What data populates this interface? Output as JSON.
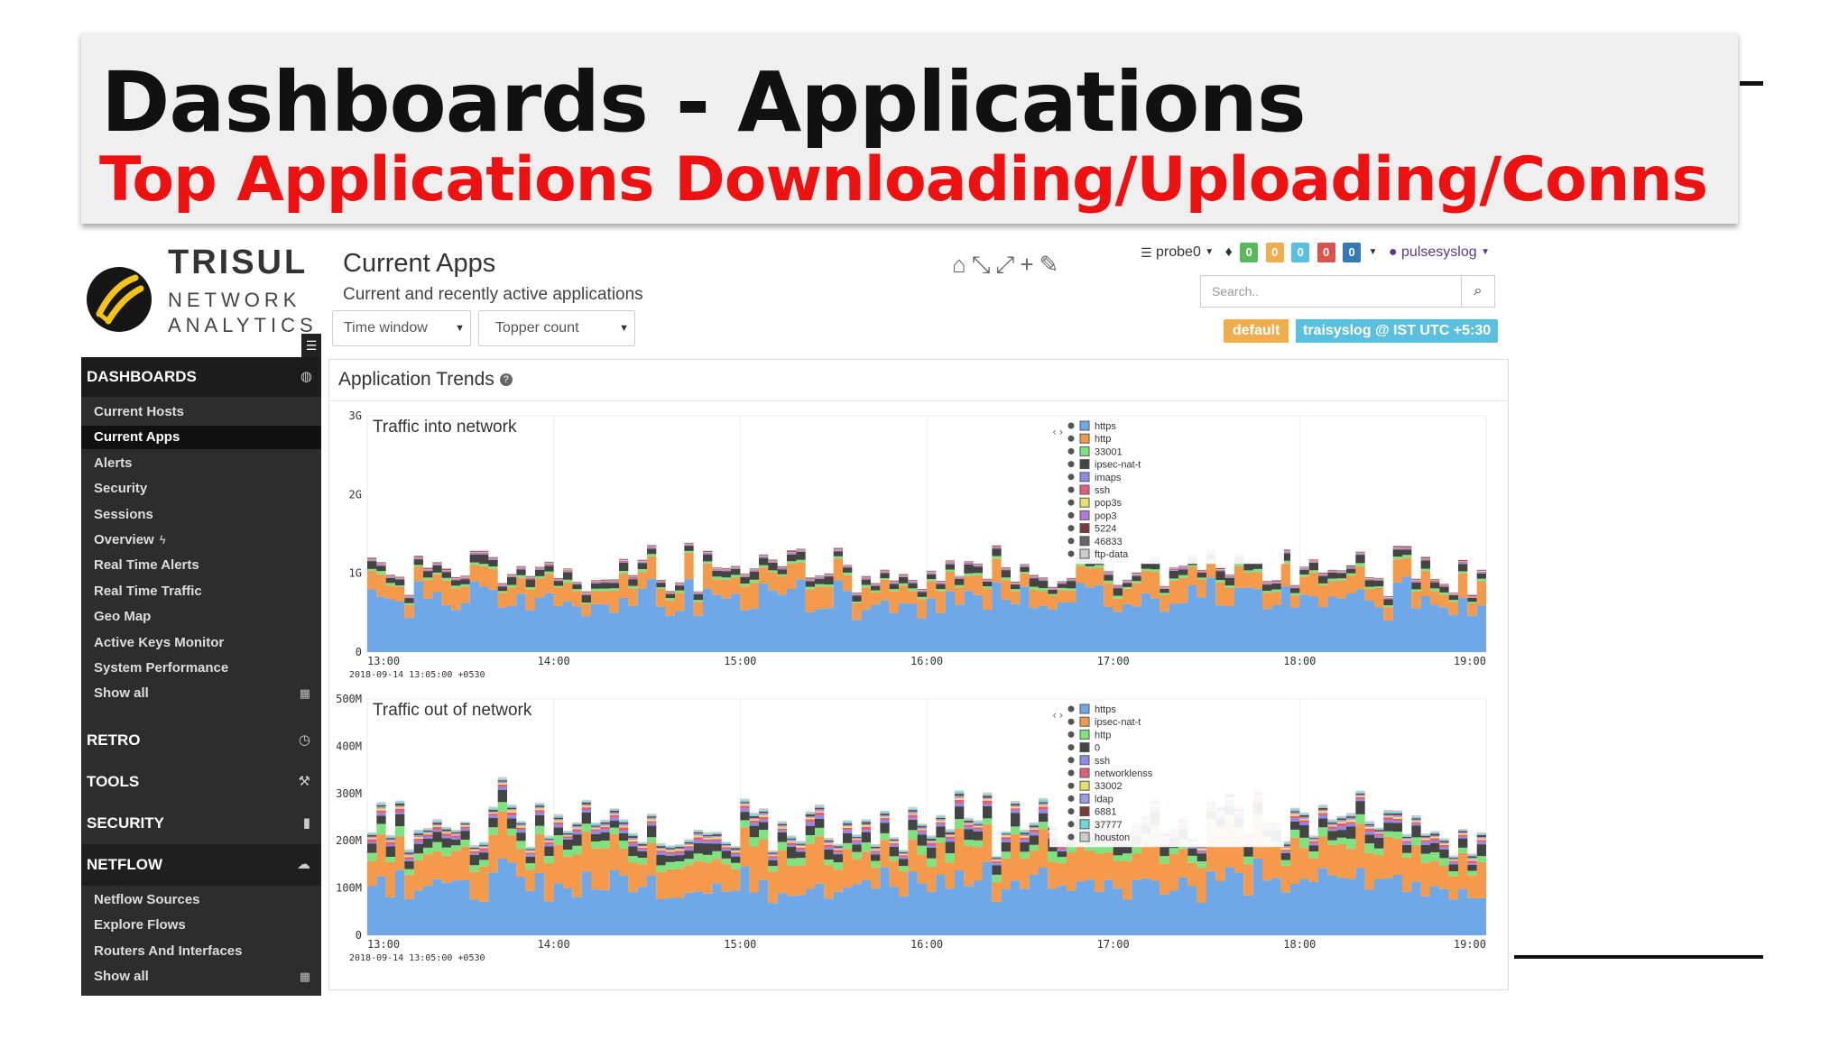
{
  "slide": {
    "title": "Dashboards - Applications",
    "subtitle": "Top Applications Downloading/Uploading/Conns"
  },
  "logo": {
    "name": "TRISUL",
    "line2": "NETWORK",
    "line3": "ANALYTICS"
  },
  "sidebar": {
    "dashboards_label": "DASHBOARDS",
    "dashboard_items": [
      {
        "label": "Current Hosts"
      },
      {
        "label": "Current Apps",
        "active": true
      },
      {
        "label": "Alerts"
      },
      {
        "label": "Security"
      },
      {
        "label": "Sessions"
      },
      {
        "label": "Overview"
      },
      {
        "label": "Real Time Alerts"
      },
      {
        "label": "Real Time Traffic"
      },
      {
        "label": "Geo Map"
      },
      {
        "label": "Active Keys Monitor"
      },
      {
        "label": "System Performance"
      },
      {
        "label": "Show all"
      }
    ],
    "sections": [
      {
        "label": "RETRO",
        "icon": "clock-icon"
      },
      {
        "label": "TOOLS",
        "icon": "wrench-icon"
      },
      {
        "label": "SECURITY",
        "icon": "lock-icon"
      },
      {
        "label": "NETFLOW",
        "icon": "cloud-icon"
      }
    ],
    "netflow_items": [
      {
        "label": "Netflow Sources"
      },
      {
        "label": "Explore Flows"
      },
      {
        "label": "Routers And Interfaces"
      },
      {
        "label": "Show all"
      }
    ]
  },
  "header": {
    "title": "Current Apps",
    "subtitle": "Current and recently active applications",
    "time_window": "Time window",
    "topper_count": "Topper count",
    "probe": "probe0",
    "badges": [
      {
        "value": "0",
        "color": "#5cb85c"
      },
      {
        "value": "0",
        "color": "#f0ad4e"
      },
      {
        "value": "0",
        "color": "#5bc0de"
      },
      {
        "value": "0",
        "color": "#d9534f"
      },
      {
        "value": "0",
        "color": "#337ab7"
      }
    ],
    "user": "pulsesyslog",
    "search_placeholder": "Search..",
    "tz_default": "default",
    "tz_label": "traisyslog @ IST UTC +5:30"
  },
  "panel": {
    "title": "Application Trends"
  },
  "chart_data": [
    {
      "type": "area",
      "title": "Traffic into network",
      "x": [
        "13:00",
        "14:00",
        "15:00",
        "16:00",
        "17:00",
        "18:00",
        "19:00"
      ],
      "x_start_label": "2018-09-14 13:05:00 +0530",
      "y_ticks": [
        "0",
        "1G",
        "2G",
        "3G"
      ],
      "ylim": [
        0,
        3000000000
      ],
      "legend_position": "top-right",
      "series": [
        {
          "name": "https",
          "color": "#6fa8e8",
          "level": 650000000
        },
        {
          "name": "http",
          "color": "#f49a4a",
          "level": 230000000
        },
        {
          "name": "33001",
          "color": "#7ee27e",
          "level": 30000000
        },
        {
          "name": "ipsec-nat-t",
          "color": "#444444",
          "level": 80000000
        },
        {
          "name": "imaps",
          "color": "#8c8ce8",
          "level": 10000000
        },
        {
          "name": "ssh",
          "color": "#e85a7a",
          "level": 10000000
        },
        {
          "name": "pop3s",
          "color": "#e8e06a",
          "level": 5000000
        },
        {
          "name": "pop3",
          "color": "#b07ad8",
          "level": 5000000
        },
        {
          "name": "5224",
          "color": "#7a3a3a",
          "level": 5000000
        },
        {
          "name": "46833",
          "color": "#666666",
          "level": 5000000
        },
        {
          "name": "ftp-data",
          "color": "#cccccc",
          "level": 5000000
        }
      ]
    },
    {
      "type": "area",
      "title": "Traffic out of network",
      "x": [
        "13:00",
        "14:00",
        "15:00",
        "16:00",
        "17:00",
        "18:00",
        "19:00"
      ],
      "x_start_label": "2018-09-14 13:05:00 +0530",
      "y_ticks": [
        "0",
        "100M",
        "200M",
        "300M",
        "400M",
        "500M"
      ],
      "ylim": [
        0,
        500000000
      ],
      "legend_position": "top-right",
      "series": [
        {
          "name": "https",
          "color": "#6fa8e8",
          "level": 110000000
        },
        {
          "name": "ipsec-nat-t",
          "color": "#f49a4a",
          "level": 70000000
        },
        {
          "name": "http",
          "color": "#7ee27e",
          "level": 15000000
        },
        {
          "name": "0",
          "color": "#444444",
          "level": 20000000
        },
        {
          "name": "ssh",
          "color": "#8c8ce8",
          "level": 5000000
        },
        {
          "name": "networklenss",
          "color": "#e85a7a",
          "level": 5000000
        },
        {
          "name": "33002",
          "color": "#e8e06a",
          "level": 3000000
        },
        {
          "name": "ldap",
          "color": "#9a9ae8",
          "level": 3000000
        },
        {
          "name": "6881",
          "color": "#7a3a3a",
          "level": 3000000
        },
        {
          "name": "37777",
          "color": "#6ad8d8",
          "level": 3000000
        },
        {
          "name": "houston",
          "color": "#cccccc",
          "level": 3000000
        }
      ]
    }
  ]
}
